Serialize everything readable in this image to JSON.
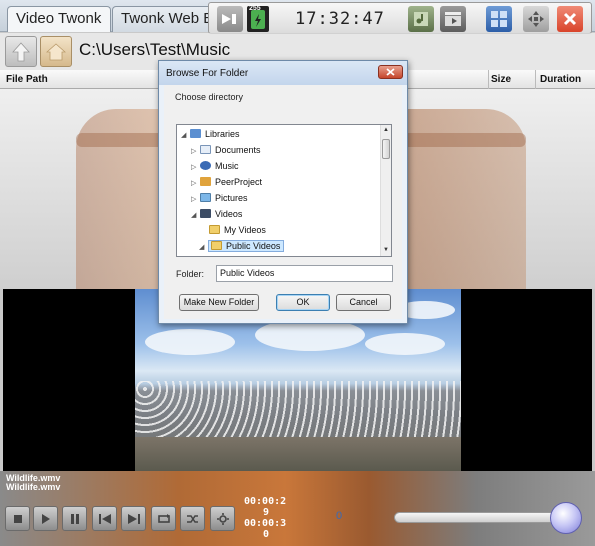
{
  "tabs": [
    {
      "label": "Video Twonk"
    },
    {
      "label": "Twonk Web B"
    }
  ],
  "toolbar": {
    "clock": "17:32:47",
    "badge": "255",
    "icons": [
      "next-track-icon",
      "battery-icon",
      "media-icon",
      "clapper-icon",
      "grid-view-icon",
      "move-icon",
      "close-icon"
    ]
  },
  "path": {
    "text": "C:\\Users\\Test\\Music"
  },
  "columns": {
    "file_path": "File Path",
    "size": "Size",
    "duration": "Duration"
  },
  "dialog": {
    "title": "Browse For Folder",
    "close": "x",
    "prompt": "Choose directory",
    "tree": [
      {
        "label": "Libraries",
        "icon": "libraries-icon",
        "expanded": true
      },
      {
        "label": "Documents",
        "icon": "documents-icon"
      },
      {
        "label": "Music",
        "icon": "music-icon"
      },
      {
        "label": "PeerProject",
        "icon": "peerproject-icon"
      },
      {
        "label": "Pictures",
        "icon": "pictures-icon"
      },
      {
        "label": "Videos",
        "icon": "videos-icon",
        "expanded": true
      },
      {
        "label": "My Videos",
        "icon": "folder-icon"
      },
      {
        "label": "Public Videos",
        "icon": "folder-icon",
        "selected": true
      }
    ],
    "folder_label": "Folder:",
    "folder_value": "Public Videos",
    "buttons": {
      "make_new_folder": "Make New Folder",
      "ok": "OK",
      "cancel": "Cancel"
    }
  },
  "player": {
    "file_line_1": "Wildlife.wmv",
    "file_line_2": "Wildlife.wmv",
    "time_1a": "00:00:2",
    "time_1b": "9",
    "time_2a": "00:00:3",
    "time_2b": "0",
    "volume_readout": "0",
    "seek_fraction": 0.97
  },
  "colors": {
    "accent_blue": "#3a6bb5",
    "close_red": "#d9442b",
    "battery_green": "#4caf50"
  }
}
